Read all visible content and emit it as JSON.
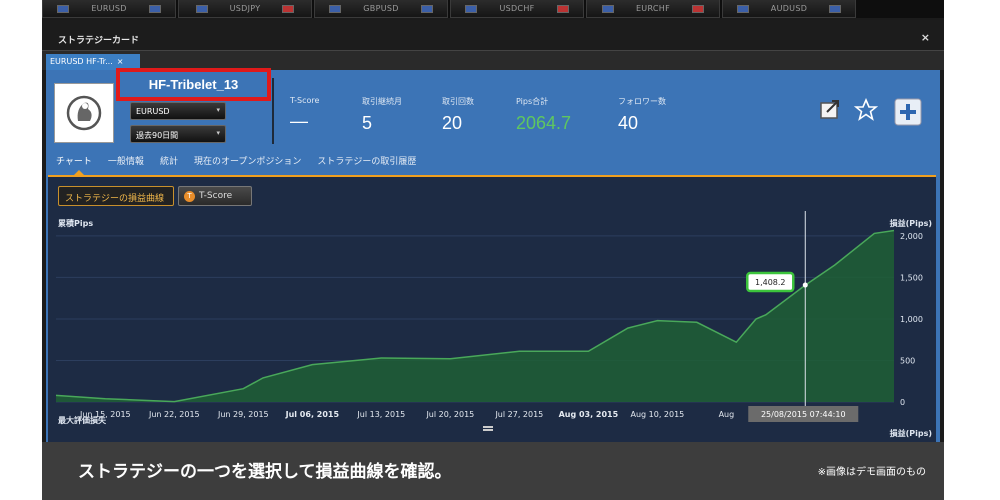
{
  "ticker": [
    "EURUSD",
    "USDJPY",
    "GBPUSD",
    "USDCHF",
    "EURCHF",
    "AUDUSD"
  ],
  "dialog": {
    "title": "ストラテジーカード",
    "close": "×"
  },
  "tab": {
    "label": "EURUSD HF-Tr...",
    "close": "×"
  },
  "strategy": {
    "name": "HF-Tribelet_13",
    "pair_select": "EURUSD",
    "period_select": "過去90日間"
  },
  "stats": [
    {
      "label": "T-Score",
      "value": "—"
    },
    {
      "label": "取引継続月",
      "value": "5"
    },
    {
      "label": "取引回数",
      "value": "20"
    },
    {
      "label": "Pips合計",
      "value": "2064.7"
    },
    {
      "label": "フォロワー数",
      "value": "40"
    }
  ],
  "subtabs": [
    "チャート",
    "一般情報",
    "統計",
    "現在のオープンポジション",
    "ストラテジーの取引履歴"
  ],
  "chart_buttons": {
    "pnl": "ストラテジーの損益曲線",
    "tscore": "T-Score"
  },
  "axis_labels": {
    "left_top": "累積Pips",
    "right_top": "損益(Pips)",
    "left_bottom": "最大評価損失",
    "right_bottom": "損益(Pips)"
  },
  "tooltip": {
    "value": "1,408.2",
    "time": "25/08/2015 07:44:10"
  },
  "colors": {
    "accent": "#f0a020",
    "panel": "#3c74b6",
    "area": "#1f5f35",
    "line": "#49a85a",
    "highlight": "#e01a1a"
  },
  "chart_data": {
    "type": "area",
    "x": [
      "2015-06-10",
      "2015-06-15",
      "2015-06-22",
      "2015-06-29",
      "2015-07-01",
      "2015-07-06",
      "2015-07-13",
      "2015-07-20",
      "2015-07-27",
      "2015-08-03",
      "2015-08-07",
      "2015-08-10",
      "2015-08-14",
      "2015-08-18",
      "2015-08-20",
      "2015-08-21",
      "2015-08-25",
      "2015-08-28",
      "2015-09-01",
      "2015-09-03"
    ],
    "values": [
      80,
      40,
      5,
      160,
      290,
      450,
      530,
      520,
      610,
      610,
      890,
      980,
      960,
      720,
      1000,
      1050,
      1408.2,
      1650,
      2030,
      2064.7
    ],
    "xticks": [
      "Jun 15, 2015",
      "Jun 22, 2015",
      "Jun 29, 2015",
      "Jul 06, 2015",
      "Jul 13, 2015",
      "Jul 20, 2015",
      "Jul 27, 2015",
      "Aug 03, 2015",
      "Aug 10, 2015",
      "Aug"
    ],
    "yticks": [
      "0",
      "500",
      "1,000",
      "1,500",
      "2,000"
    ],
    "ylim": [
      0,
      2300
    ],
    "ylabel": "損益(Pips)"
  },
  "banner": {
    "message": "ストラテジーの一つを選択して損益曲線を確認。",
    "note": "※画像はデモ画面のもの"
  }
}
